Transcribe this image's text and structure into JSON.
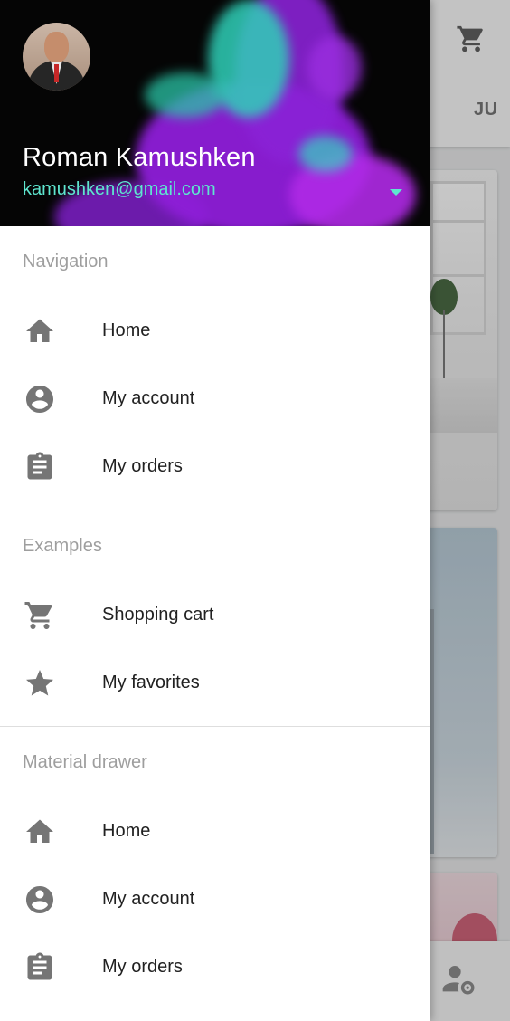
{
  "background": {
    "appbar_tab_partial": "JU"
  },
  "drawer": {
    "user": {
      "name": "Roman Kamushken",
      "email": "kamushken@gmail.com"
    },
    "sections": [
      {
        "header": "Navigation",
        "items": [
          {
            "label": "Home",
            "icon": "home-icon"
          },
          {
            "label": "My account",
            "icon": "account-circle-icon"
          },
          {
            "label": "My orders",
            "icon": "clipboard-icon"
          }
        ]
      },
      {
        "header": "Examples",
        "items": [
          {
            "label": "Shopping cart",
            "icon": "cart-icon"
          },
          {
            "label": "My favorites",
            "icon": "star-icon"
          }
        ]
      },
      {
        "header": "Material drawer",
        "items": [
          {
            "label": "Home",
            "icon": "home-icon"
          },
          {
            "label": "My account",
            "icon": "account-circle-icon"
          },
          {
            "label": "My orders",
            "icon": "clipboard-icon"
          }
        ]
      }
    ]
  },
  "colors": {
    "email_accent": "#5ee6cf",
    "icon_gray": "#757575",
    "section_header": "#9e9e9e"
  }
}
